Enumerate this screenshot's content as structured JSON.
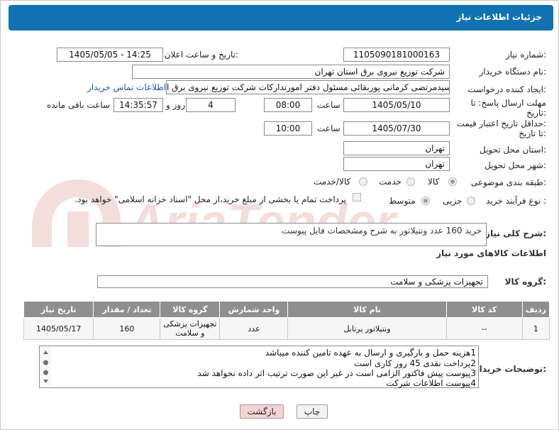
{
  "header": {
    "title": "جزئیات اطلاعات نیاز"
  },
  "form": {
    "need_number_label": "شماره نیاز:",
    "need_number": "1105090181000163",
    "announce_label": "تاریخ و ساعت اعلان عمومی:",
    "announce_value": "1405/05/05 - 14:25",
    "buyer_org_label": "نام دستگاه خریدار:",
    "buyer_org": "شرکت توزیع نیروی برق استان تهران",
    "creator_label": "ایجاد کننده درخواست:",
    "creator": "سیدمرتضی کرمانی پوربقائی مسئول دفتر امورتدارکات شرکت توزیع نیروی برق ا",
    "contact_link": "اطلاعات تماس خریدار",
    "deadline_label_1": "مهلت ارسال پاسخ: تا",
    "deadline_label_2": "تاریخ:",
    "deadline_date": "1405/05/10",
    "time_label": "ساعت",
    "deadline_time": "08:00",
    "days": "4",
    "days_label": "روز و",
    "remaining": "14:35:57",
    "remaining_label": "ساعت باقی مانده",
    "price_label_1": "حداقل تاریخ اعتبار قیمت:",
    "price_label_2": "تا تاریخ:",
    "price_date": "1405/07/30",
    "price_time_label": "ساعت",
    "price_time": "10:00",
    "province_label": "استان محل تحویل:",
    "province": "تهران",
    "city_label": "شهر محل تحویل:",
    "city": "تهران",
    "category_label": "طبقه بندی موضوعی:",
    "category_options": [
      "کالا",
      "خدمت",
      "کالا/خدمت"
    ],
    "category_selected": "کالا",
    "process_label": "نوع فرآیند خرید :",
    "process_options": [
      "جزیی",
      "متوسط"
    ],
    "process_selected": "متوسط",
    "payment_note": "پرداخت تمام یا بخشی از مبلغ خرید،از محل \"اسناد خزانه اسلامی\" خواهد بود."
  },
  "description": {
    "label": "شرح کلی نیاز:",
    "text": "خرید 160 عدد ونتیلاتور به شرح ومشخصات فایل پیوست"
  },
  "goods": {
    "section_title": "اطلاعات کالاهای مورد نیاز",
    "group_label": "گروه کالا:",
    "group_value": "تجهیزات پزشکی و سلامت",
    "columns": [
      "ردیف",
      "کد کالا",
      "نام کالا",
      "واحد شمارش",
      "گروه کالا",
      "تعداد / مقدار",
      "تاریخ نیاز"
    ],
    "rows": [
      [
        "1",
        "--",
        "ونتیلاتور پرتابل",
        "عدد",
        "تجهیزات پزشکی و سلامت",
        "160",
        "1405/05/17"
      ]
    ]
  },
  "buyer_notes": {
    "label": "توضیحات خریدار:",
    "lines": [
      "1هزینه حمل و بارگیری و ارسال به عهده تامین کننده میباشد",
      "2پرداخت نقدی 45 روز کاری است",
      "3پیوست پیش فاکتور الزامی است در غیر این صورت ترتیب اثر داده نخواهد شد",
      "4پیوست اطلاعات شرکت"
    ]
  },
  "buttons": {
    "print": "چاپ",
    "back": "بازگشت"
  },
  "colors": {
    "header": "#1172b2",
    "table_header": "#8f8f8f",
    "link": "#1a55c0",
    "back_button": "#f6d3d3"
  },
  "watermark_text": "AriaTender.net"
}
